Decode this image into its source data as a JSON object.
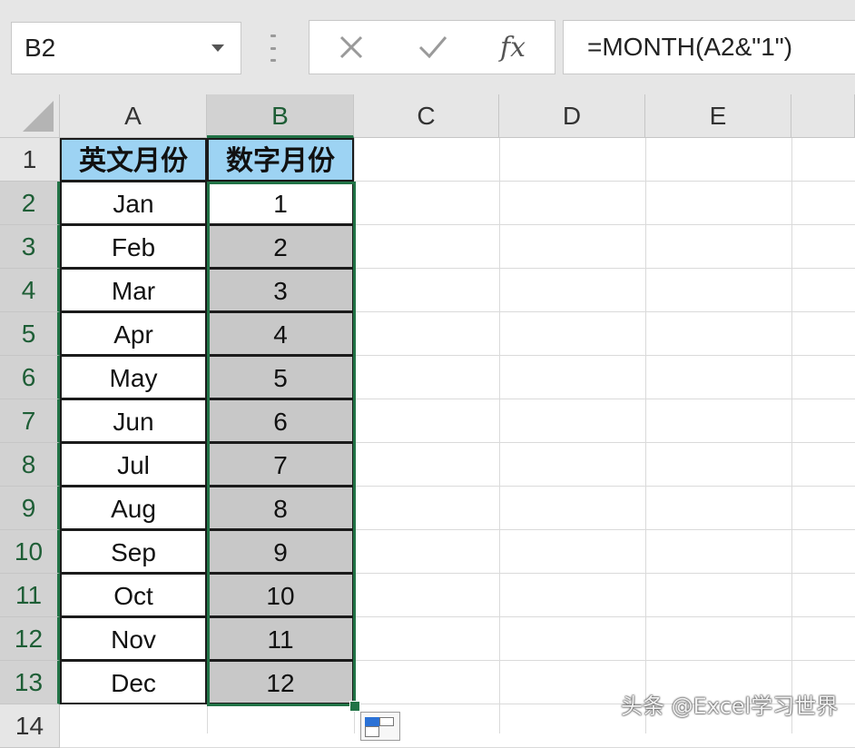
{
  "name_box": {
    "value": "B2"
  },
  "formula_bar": {
    "cancel_icon": "close-icon",
    "enter_icon": "checkmark-icon",
    "fx_label": "fx",
    "formula": "=MONTH(A2&\"1\")"
  },
  "columns": [
    "A",
    "B",
    "C",
    "D",
    "E"
  ],
  "selected_column": "B",
  "rows": [
    "1",
    "2",
    "3",
    "4",
    "5",
    "6",
    "7",
    "8",
    "9",
    "10",
    "11",
    "12",
    "13",
    "14"
  ],
  "table": {
    "headers": [
      "英文月份",
      "数字月份"
    ],
    "rows": [
      [
        "Jan",
        "1"
      ],
      [
        "Feb",
        "2"
      ],
      [
        "Mar",
        "3"
      ],
      [
        "Apr",
        "4"
      ],
      [
        "May",
        "5"
      ],
      [
        "Jun",
        "6"
      ],
      [
        "Jul",
        "7"
      ],
      [
        "Aug",
        "8"
      ],
      [
        "Sep",
        "9"
      ],
      [
        "Oct",
        "10"
      ],
      [
        "Nov",
        "11"
      ],
      [
        "Dec",
        "12"
      ]
    ]
  },
  "watermark": "头条 @Excel学习世界",
  "colors": {
    "header_fill": "#9dd3f3",
    "selection_fill": "#c8c8c8",
    "selection_border": "#217346"
  }
}
